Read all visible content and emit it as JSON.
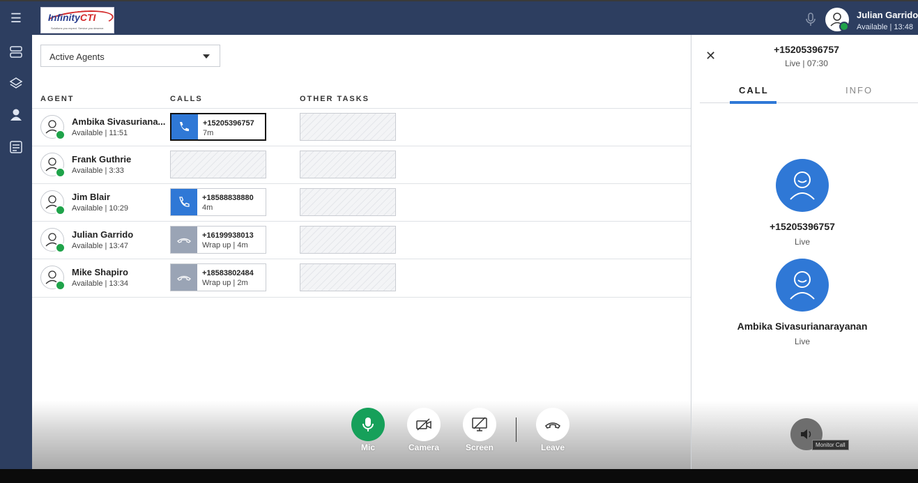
{
  "header": {
    "logo_text_a": "Infinity",
    "logo_text_b": "CTI",
    "logo_tagline": "Solutions you expect. Service you deserve.",
    "user_name": "Julian Garrido",
    "user_status": "Available | 13:48"
  },
  "filter": {
    "selected": "Active Agents"
  },
  "columns": {
    "agent": "AGENT",
    "calls": "CALLS",
    "other_tasks": "OTHER TASKS"
  },
  "agents": [
    {
      "name": "Ambika Sivasuriana...",
      "status": "Available | 11:51",
      "call": {
        "number": "+15205396757",
        "sub": "7m",
        "state": "active-selected"
      }
    },
    {
      "name": "Frank Guthrie",
      "status": "Available | 3:33",
      "call": null
    },
    {
      "name": "Jim Blair",
      "status": "Available | 10:29",
      "call": {
        "number": "+18588838880",
        "sub": "4m",
        "state": "active"
      }
    },
    {
      "name": "Julian Garrido",
      "status": "Available | 13:47",
      "call": {
        "number": "+16199938013",
        "sub": "Wrap up | 4m",
        "state": "wrapup"
      }
    },
    {
      "name": "Mike Shapiro",
      "status": "Available | 13:34",
      "call": {
        "number": "+18583802484",
        "sub": "Wrap up | 2m",
        "state": "wrapup"
      }
    }
  ],
  "controls": {
    "mic": "Mic",
    "camera": "Camera",
    "screen": "Screen",
    "leave": "Leave"
  },
  "call_panel": {
    "number": "+15205396757",
    "status": "Live | 07:30",
    "tabs": [
      "CALL",
      "INFO"
    ],
    "participants": [
      {
        "name": "+15205396757",
        "status": "Live"
      },
      {
        "name": "Ambika Sivasurianarayanan",
        "status": "Live"
      }
    ],
    "monitor_tooltip": "Monitor Call"
  },
  "colors": {
    "brand_navy": "#2d3e60",
    "accent_blue": "#2f78d6",
    "mic_green": "#16a05a",
    "available_green": "#1fa34a"
  }
}
